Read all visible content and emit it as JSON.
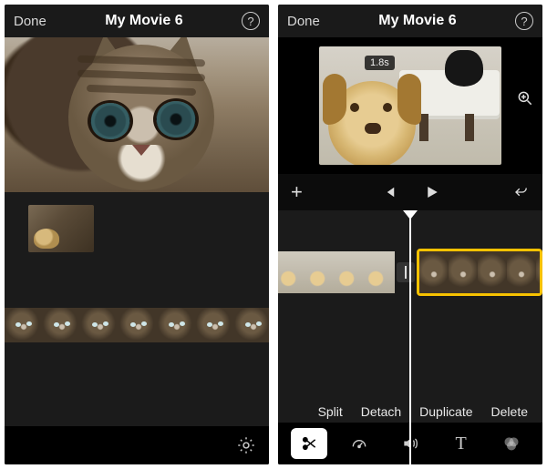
{
  "left": {
    "header": {
      "done": "Done",
      "title": "My Movie 6",
      "help": "?"
    },
    "preview": {
      "name": "cat-closeup-preview"
    },
    "media_bin": {
      "thumb_name": "dog-clip-thumbnail"
    },
    "timeline": {
      "clip_name": "cat-clip",
      "frame_count": 7
    },
    "footer": {
      "settings_icon": "gear-icon"
    }
  },
  "right": {
    "header": {
      "done": "Done",
      "title": "My Movie 6",
      "help": "?"
    },
    "preview": {
      "name": "dog-and-black-cat-preview",
      "time_badge": "1.8s",
      "zoom_icon": "magnifier-zoom-icon"
    },
    "transport": {
      "add": "+",
      "skip_back_icon": "skip-back-icon",
      "play_icon": "play-icon",
      "undo_icon": "undo-icon"
    },
    "timeline": {
      "clip_a_name": "dog-clip",
      "transition_name": "cut-transition",
      "clip_b_name": "cat-clip",
      "clip_b_selected": true,
      "selection_color": "#f7c200"
    },
    "edit_actions": {
      "split": "Split",
      "detach": "Detach",
      "duplicate": "Duplicate",
      "delete": "Delete"
    },
    "tools": {
      "scissors": "scissors-icon",
      "speed": "speedometer-icon",
      "volume": "volume-icon",
      "text": "T",
      "filters": "filters-icon",
      "selected": "scissors"
    }
  }
}
